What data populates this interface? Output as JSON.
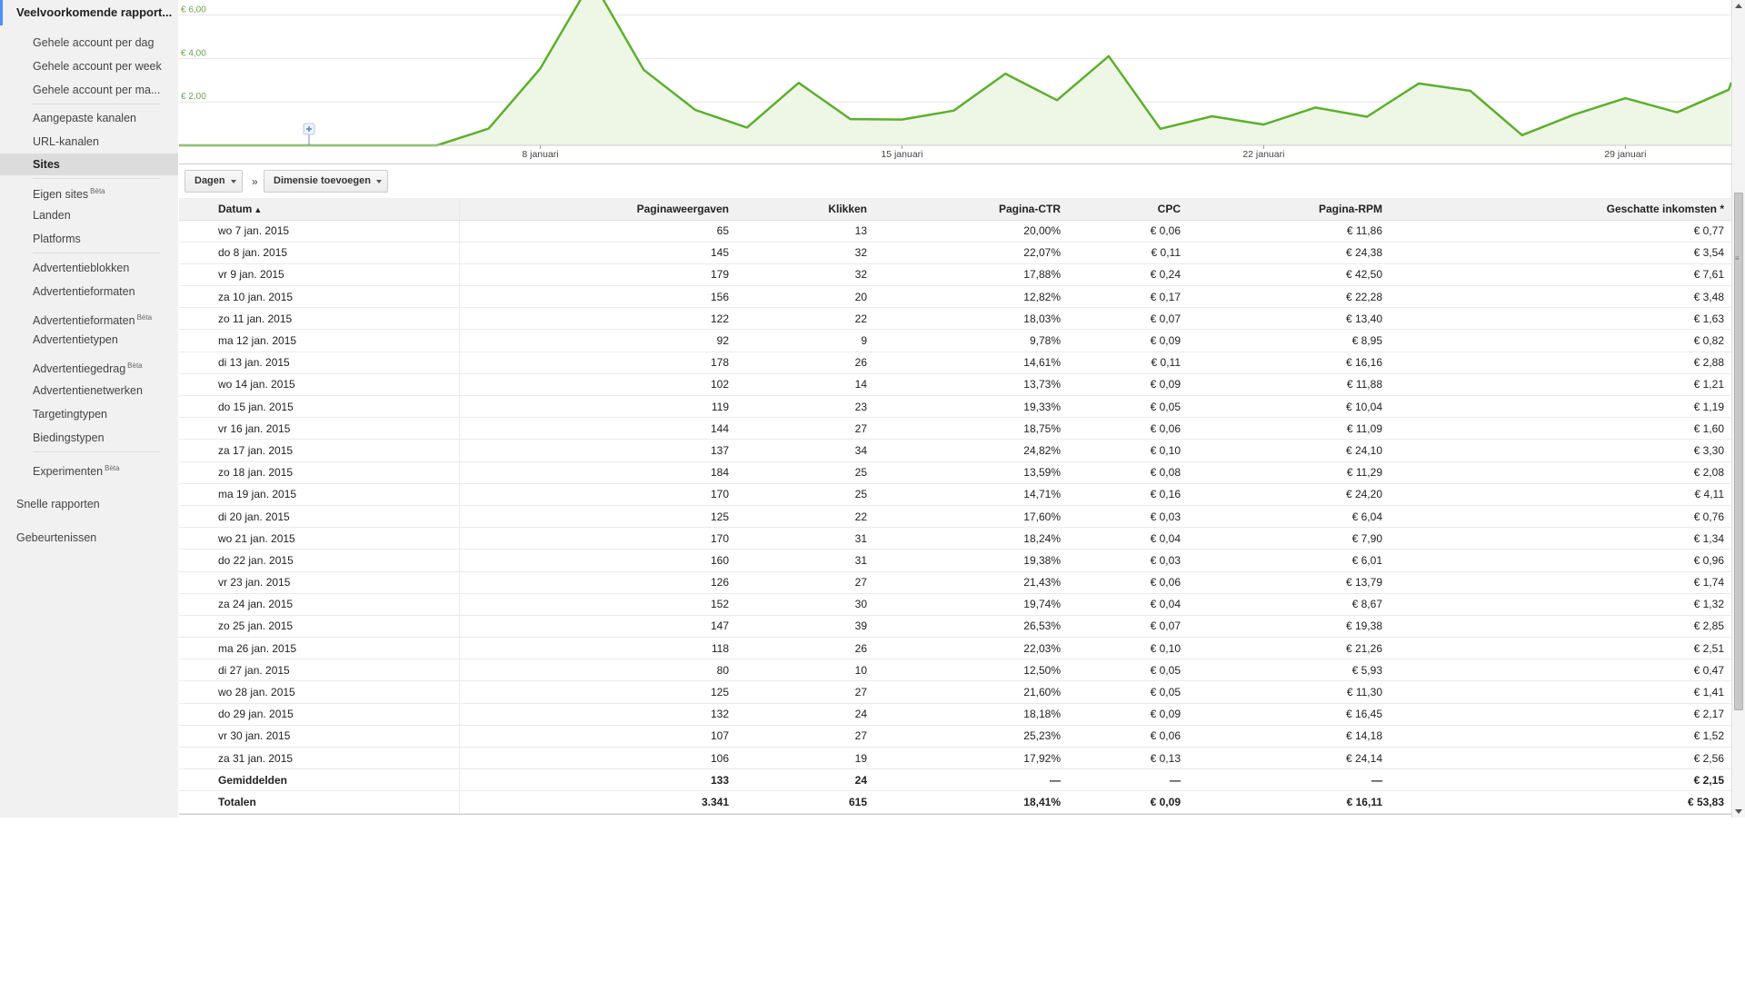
{
  "sidebar": {
    "title": "Veelvoorkomende rapport...",
    "group1": [
      "Gehele account per dag",
      "Gehele account per week",
      "Gehele account per ma..."
    ],
    "group2": [
      "Aangepaste kanalen",
      "URL-kanalen",
      "Sites"
    ],
    "group3": [
      {
        "label": "Eigen sites",
        "beta": "Bèta"
      },
      {
        "label": "Landen"
      },
      {
        "label": "Platforms"
      }
    ],
    "group4": [
      {
        "label": "Advertentieblokken"
      },
      {
        "label": "Advertentieformaten"
      },
      {
        "label": "Advertentieformaten",
        "beta": "Bèta"
      },
      {
        "label": "Advertentietypen"
      },
      {
        "label": "Advertentiegedrag",
        "beta": "Bèta"
      },
      {
        "label": "Advertentienetwerken"
      },
      {
        "label": "Targetingtypen"
      },
      {
        "label": "Biedingstypen"
      }
    ],
    "experiments": {
      "label": "Experimenten",
      "beta": "Bèta"
    },
    "quick_reports": "Snelle rapporten",
    "events": "Gebeurtenissen"
  },
  "chart_data": {
    "type": "area",
    "series_color": "#5cb02c",
    "fill_color": "#eef7e6",
    "y_ticks": [
      "€ 2,00",
      "€ 4,00",
      "€ 6,00"
    ],
    "y_tick_values": [
      2,
      4,
      6
    ],
    "x_ticks": [
      {
        "label": "8 januari",
        "index": 1
      },
      {
        "label": "15 januari",
        "index": 8
      },
      {
        "label": "22 januari",
        "index": 15
      },
      {
        "label": "29 januari",
        "index": 22
      }
    ],
    "values": [
      0,
      0,
      0,
      0,
      0,
      0,
      0,
      0.77,
      3.54,
      7.61,
      3.48,
      1.63,
      0.82,
      2.88,
      1.21,
      1.19,
      1.6,
      3.3,
      2.08,
      4.11,
      0.76,
      1.34,
      0.96,
      1.74,
      1.32,
      2.85,
      2.51,
      0.47,
      1.41,
      2.17,
      1.52,
      2.56
    ],
    "x_index_offset": 7,
    "ylim": [
      0,
      6.4
    ],
    "grid": true
  },
  "toolbar": {
    "period_label": "Dagen",
    "separator": "»",
    "add_dimension_label": "Dimensie toevoegen"
  },
  "table": {
    "columns": [
      "Datum",
      "Paginaweergaven",
      "Klikken",
      "Pagina-CTR",
      "CPC",
      "Pagina-RPM",
      "Geschatte inkomsten *"
    ],
    "sort_indicator": "▲",
    "rows": [
      [
        "wo 7 jan. 2015",
        "65",
        "13",
        "20,00%",
        "€ 0,06",
        "€ 11,86",
        "€ 0,77"
      ],
      [
        "do 8 jan. 2015",
        "145",
        "32",
        "22,07%",
        "€ 0,11",
        "€ 24,38",
        "€ 3,54"
      ],
      [
        "vr 9 jan. 2015",
        "179",
        "32",
        "17,88%",
        "€ 0,24",
        "€ 42,50",
        "€ 7,61"
      ],
      [
        "za 10 jan. 2015",
        "156",
        "20",
        "12,82%",
        "€ 0,17",
        "€ 22,28",
        "€ 3,48"
      ],
      [
        "zo 11 jan. 2015",
        "122",
        "22",
        "18,03%",
        "€ 0,07",
        "€ 13,40",
        "€ 1,63"
      ],
      [
        "ma 12 jan. 2015",
        "92",
        "9",
        "9,78%",
        "€ 0,09",
        "€ 8,95",
        "€ 0,82"
      ],
      [
        "di 13 jan. 2015",
        "178",
        "26",
        "14,61%",
        "€ 0,11",
        "€ 16,16",
        "€ 2,88"
      ],
      [
        "wo 14 jan. 2015",
        "102",
        "14",
        "13,73%",
        "€ 0,09",
        "€ 11,88",
        "€ 1,21"
      ],
      [
        "do 15 jan. 2015",
        "119",
        "23",
        "19,33%",
        "€ 0,05",
        "€ 10,04",
        "€ 1,19"
      ],
      [
        "vr 16 jan. 2015",
        "144",
        "27",
        "18,75%",
        "€ 0,06",
        "€ 11,09",
        "€ 1,60"
      ],
      [
        "za 17 jan. 2015",
        "137",
        "34",
        "24,82%",
        "€ 0,10",
        "€ 24,10",
        "€ 3,30"
      ],
      [
        "zo 18 jan. 2015",
        "184",
        "25",
        "13,59%",
        "€ 0,08",
        "€ 11,29",
        "€ 2,08"
      ],
      [
        "ma 19 jan. 2015",
        "170",
        "25",
        "14,71%",
        "€ 0,16",
        "€ 24,20",
        "€ 4,11"
      ],
      [
        "di 20 jan. 2015",
        "125",
        "22",
        "17,60%",
        "€ 0,03",
        "€ 6,04",
        "€ 0,76"
      ],
      [
        "wo 21 jan. 2015",
        "170",
        "31",
        "18,24%",
        "€ 0,04",
        "€ 7,90",
        "€ 1,34"
      ],
      [
        "do 22 jan. 2015",
        "160",
        "31",
        "19,38%",
        "€ 0,03",
        "€ 6,01",
        "€ 0,96"
      ],
      [
        "vr 23 jan. 2015",
        "126",
        "27",
        "21,43%",
        "€ 0,06",
        "€ 13,79",
        "€ 1,74"
      ],
      [
        "za 24 jan. 2015",
        "152",
        "30",
        "19,74%",
        "€ 0,04",
        "€ 8,67",
        "€ 1,32"
      ],
      [
        "zo 25 jan. 2015",
        "147",
        "39",
        "26,53%",
        "€ 0,07",
        "€ 19,38",
        "€ 2,85"
      ],
      [
        "ma 26 jan. 2015",
        "118",
        "26",
        "22,03%",
        "€ 0,10",
        "€ 21,26",
        "€ 2,51"
      ],
      [
        "di 27 jan. 2015",
        "80",
        "10",
        "12,50%",
        "€ 0,05",
        "€ 5,93",
        "€ 0,47"
      ],
      [
        "wo 28 jan. 2015",
        "125",
        "27",
        "21,60%",
        "€ 0,05",
        "€ 11,30",
        "€ 1,41"
      ],
      [
        "do 29 jan. 2015",
        "132",
        "24",
        "18,18%",
        "€ 0,09",
        "€ 16,45",
        "€ 2,17"
      ],
      [
        "vr 30 jan. 2015",
        "107",
        "27",
        "25,23%",
        "€ 0,06",
        "€ 14,18",
        "€ 1,52"
      ],
      [
        "za 31 jan. 2015",
        "106",
        "19",
        "17,92%",
        "€ 0,13",
        "€ 24,14",
        "€ 2,56"
      ]
    ],
    "summary": [
      [
        "Gemiddelden",
        "133",
        "24",
        "—",
        "—",
        "—",
        "€ 2,15"
      ],
      [
        "Totalen",
        "3.341",
        "615",
        "18,41%",
        "€ 0,09",
        "€ 16,11",
        "€ 53,83"
      ]
    ]
  }
}
